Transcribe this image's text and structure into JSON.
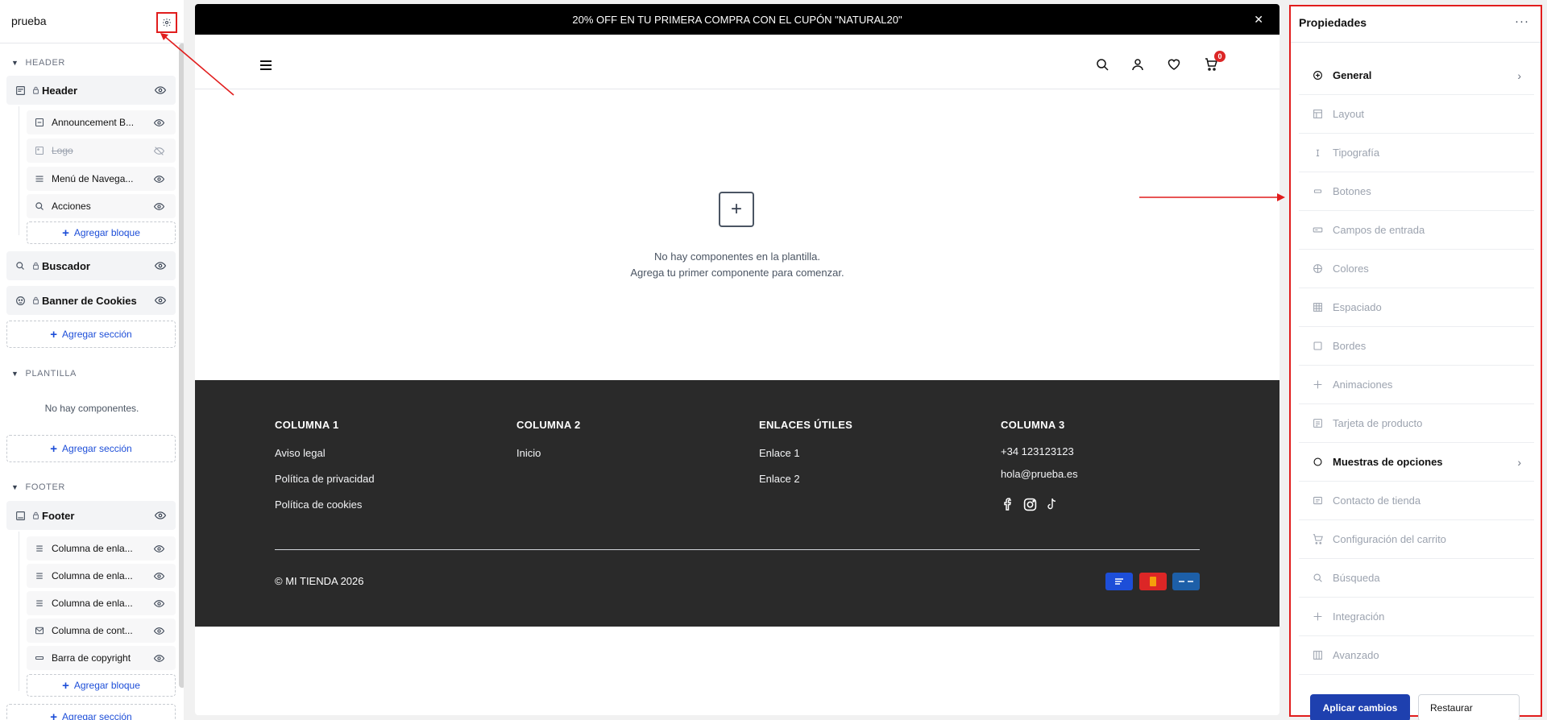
{
  "sidebar": {
    "template_name": "prueba",
    "sections": {
      "header": {
        "label": "HEADER",
        "group_label": "Header",
        "blocks": [
          {
            "label": "Announcement B...",
            "icon": "announcement-icon"
          },
          {
            "label": "Logo",
            "icon": "image-icon",
            "hidden": true
          },
          {
            "label": "Menú de Navega...",
            "icon": "menu-icon"
          },
          {
            "label": "Acciones",
            "icon": "search-icon"
          }
        ],
        "add_block": "Agregar bloque",
        "extra_sections": [
          {
            "label": "Buscador",
            "icon": "search-icon"
          },
          {
            "label": "Banner de Cookies",
            "icon": "cookie-icon"
          }
        ],
        "add_section": "Agregar sección"
      },
      "plantilla": {
        "label": "PLANTILLA",
        "empty": "No hay componentes.",
        "add_section": "Agregar sección"
      },
      "footer": {
        "label": "FOOTER",
        "group_label": "Footer",
        "blocks": [
          {
            "label": "Columna de enla...",
            "icon": "list-icon"
          },
          {
            "label": "Columna de enla...",
            "icon": "list-icon"
          },
          {
            "label": "Columna de enla...",
            "icon": "list-icon"
          },
          {
            "label": "Columna de cont...",
            "icon": "contact-icon"
          },
          {
            "label": "Barra de copyright",
            "icon": "bar-icon"
          }
        ],
        "add_block": "Agregar bloque",
        "add_section": "Agregar sección"
      }
    }
  },
  "canvas": {
    "announcement": "20% OFF EN TU PRIMERA COMPRA CON EL CUPÓN \"NATURAL20\"",
    "close_glyph": "✕",
    "cart_count": "0",
    "empty_line1": "No hay componentes en la plantilla.",
    "empty_line2": "Agrega tu primer componente para comenzar.",
    "footer": {
      "columns": [
        {
          "title": "COLUMNA 1",
          "links": [
            "Aviso legal",
            "Política de privacidad",
            "Política de cookies"
          ]
        },
        {
          "title": "COLUMNA 2",
          "links": [
            "Inicio"
          ]
        },
        {
          "title": "ENLACES ÚTILES",
          "links": [
            "Enlace 1",
            "Enlace 2"
          ]
        },
        {
          "title": "COLUMNA 3",
          "links": [
            "+34 123123123",
            "hola@prueba.es"
          ]
        }
      ],
      "copyright": "© MI TIENDA 2026",
      "payment_icons": [
        "card-blue-icon",
        "mastercard-icon",
        "card-amex-icon"
      ],
      "social_icons": [
        "facebook-icon",
        "instagram-icon",
        "tiktok-icon"
      ]
    }
  },
  "properties": {
    "title": "Propiedades",
    "more": "···",
    "items": [
      {
        "label": "General",
        "active": true,
        "has_arrow": true
      },
      {
        "label": "Layout"
      },
      {
        "label": "Tipografía"
      },
      {
        "label": "Botones"
      },
      {
        "label": "Campos de entrada"
      },
      {
        "label": "Colores"
      },
      {
        "label": "Espaciado"
      },
      {
        "label": "Bordes"
      },
      {
        "label": "Animaciones"
      },
      {
        "label": "Tarjeta de producto"
      },
      {
        "label": "Muestras de opciones",
        "active": true,
        "has_arrow": true
      },
      {
        "label": "Contacto de tienda"
      },
      {
        "label": "Configuración del carrito"
      },
      {
        "label": "Búsqueda"
      },
      {
        "label": "Integración"
      },
      {
        "label": "Avanzado"
      }
    ],
    "apply": "Aplicar cambios",
    "reset": "Restaurar"
  },
  "colors": {
    "accent": "#1e40af",
    "highlight": "#e11d1d",
    "footer_bg": "#2a2a2a",
    "announcement_bg": "#000000"
  }
}
